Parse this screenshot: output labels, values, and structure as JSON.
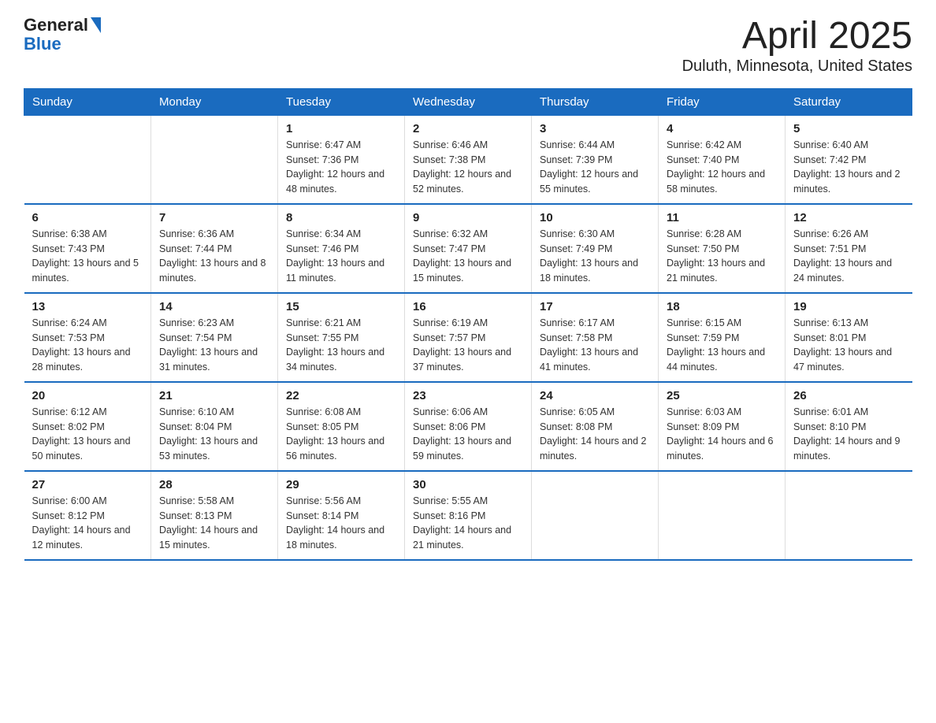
{
  "logo": {
    "text_general": "General",
    "text_blue": "Blue"
  },
  "title": "April 2025",
  "subtitle": "Duluth, Minnesota, United States",
  "weekdays": [
    "Sunday",
    "Monday",
    "Tuesday",
    "Wednesday",
    "Thursday",
    "Friday",
    "Saturday"
  ],
  "weeks": [
    [
      {
        "day": "",
        "sunrise": "",
        "sunset": "",
        "daylight": ""
      },
      {
        "day": "",
        "sunrise": "",
        "sunset": "",
        "daylight": ""
      },
      {
        "day": "1",
        "sunrise": "Sunrise: 6:47 AM",
        "sunset": "Sunset: 7:36 PM",
        "daylight": "Daylight: 12 hours and 48 minutes."
      },
      {
        "day": "2",
        "sunrise": "Sunrise: 6:46 AM",
        "sunset": "Sunset: 7:38 PM",
        "daylight": "Daylight: 12 hours and 52 minutes."
      },
      {
        "day": "3",
        "sunrise": "Sunrise: 6:44 AM",
        "sunset": "Sunset: 7:39 PM",
        "daylight": "Daylight: 12 hours and 55 minutes."
      },
      {
        "day": "4",
        "sunrise": "Sunrise: 6:42 AM",
        "sunset": "Sunset: 7:40 PM",
        "daylight": "Daylight: 12 hours and 58 minutes."
      },
      {
        "day": "5",
        "sunrise": "Sunrise: 6:40 AM",
        "sunset": "Sunset: 7:42 PM",
        "daylight": "Daylight: 13 hours and 2 minutes."
      }
    ],
    [
      {
        "day": "6",
        "sunrise": "Sunrise: 6:38 AM",
        "sunset": "Sunset: 7:43 PM",
        "daylight": "Daylight: 13 hours and 5 minutes."
      },
      {
        "day": "7",
        "sunrise": "Sunrise: 6:36 AM",
        "sunset": "Sunset: 7:44 PM",
        "daylight": "Daylight: 13 hours and 8 minutes."
      },
      {
        "day": "8",
        "sunrise": "Sunrise: 6:34 AM",
        "sunset": "Sunset: 7:46 PM",
        "daylight": "Daylight: 13 hours and 11 minutes."
      },
      {
        "day": "9",
        "sunrise": "Sunrise: 6:32 AM",
        "sunset": "Sunset: 7:47 PM",
        "daylight": "Daylight: 13 hours and 15 minutes."
      },
      {
        "day": "10",
        "sunrise": "Sunrise: 6:30 AM",
        "sunset": "Sunset: 7:49 PM",
        "daylight": "Daylight: 13 hours and 18 minutes."
      },
      {
        "day": "11",
        "sunrise": "Sunrise: 6:28 AM",
        "sunset": "Sunset: 7:50 PM",
        "daylight": "Daylight: 13 hours and 21 minutes."
      },
      {
        "day": "12",
        "sunrise": "Sunrise: 6:26 AM",
        "sunset": "Sunset: 7:51 PM",
        "daylight": "Daylight: 13 hours and 24 minutes."
      }
    ],
    [
      {
        "day": "13",
        "sunrise": "Sunrise: 6:24 AM",
        "sunset": "Sunset: 7:53 PM",
        "daylight": "Daylight: 13 hours and 28 minutes."
      },
      {
        "day": "14",
        "sunrise": "Sunrise: 6:23 AM",
        "sunset": "Sunset: 7:54 PM",
        "daylight": "Daylight: 13 hours and 31 minutes."
      },
      {
        "day": "15",
        "sunrise": "Sunrise: 6:21 AM",
        "sunset": "Sunset: 7:55 PM",
        "daylight": "Daylight: 13 hours and 34 minutes."
      },
      {
        "day": "16",
        "sunrise": "Sunrise: 6:19 AM",
        "sunset": "Sunset: 7:57 PM",
        "daylight": "Daylight: 13 hours and 37 minutes."
      },
      {
        "day": "17",
        "sunrise": "Sunrise: 6:17 AM",
        "sunset": "Sunset: 7:58 PM",
        "daylight": "Daylight: 13 hours and 41 minutes."
      },
      {
        "day": "18",
        "sunrise": "Sunrise: 6:15 AM",
        "sunset": "Sunset: 7:59 PM",
        "daylight": "Daylight: 13 hours and 44 minutes."
      },
      {
        "day": "19",
        "sunrise": "Sunrise: 6:13 AM",
        "sunset": "Sunset: 8:01 PM",
        "daylight": "Daylight: 13 hours and 47 minutes."
      }
    ],
    [
      {
        "day": "20",
        "sunrise": "Sunrise: 6:12 AM",
        "sunset": "Sunset: 8:02 PM",
        "daylight": "Daylight: 13 hours and 50 minutes."
      },
      {
        "day": "21",
        "sunrise": "Sunrise: 6:10 AM",
        "sunset": "Sunset: 8:04 PM",
        "daylight": "Daylight: 13 hours and 53 minutes."
      },
      {
        "day": "22",
        "sunrise": "Sunrise: 6:08 AM",
        "sunset": "Sunset: 8:05 PM",
        "daylight": "Daylight: 13 hours and 56 minutes."
      },
      {
        "day": "23",
        "sunrise": "Sunrise: 6:06 AM",
        "sunset": "Sunset: 8:06 PM",
        "daylight": "Daylight: 13 hours and 59 minutes."
      },
      {
        "day": "24",
        "sunrise": "Sunrise: 6:05 AM",
        "sunset": "Sunset: 8:08 PM",
        "daylight": "Daylight: 14 hours and 2 minutes."
      },
      {
        "day": "25",
        "sunrise": "Sunrise: 6:03 AM",
        "sunset": "Sunset: 8:09 PM",
        "daylight": "Daylight: 14 hours and 6 minutes."
      },
      {
        "day": "26",
        "sunrise": "Sunrise: 6:01 AM",
        "sunset": "Sunset: 8:10 PM",
        "daylight": "Daylight: 14 hours and 9 minutes."
      }
    ],
    [
      {
        "day": "27",
        "sunrise": "Sunrise: 6:00 AM",
        "sunset": "Sunset: 8:12 PM",
        "daylight": "Daylight: 14 hours and 12 minutes."
      },
      {
        "day": "28",
        "sunrise": "Sunrise: 5:58 AM",
        "sunset": "Sunset: 8:13 PM",
        "daylight": "Daylight: 14 hours and 15 minutes."
      },
      {
        "day": "29",
        "sunrise": "Sunrise: 5:56 AM",
        "sunset": "Sunset: 8:14 PM",
        "daylight": "Daylight: 14 hours and 18 minutes."
      },
      {
        "day": "30",
        "sunrise": "Sunrise: 5:55 AM",
        "sunset": "Sunset: 8:16 PM",
        "daylight": "Daylight: 14 hours and 21 minutes."
      },
      {
        "day": "",
        "sunrise": "",
        "sunset": "",
        "daylight": ""
      },
      {
        "day": "",
        "sunrise": "",
        "sunset": "",
        "daylight": ""
      },
      {
        "day": "",
        "sunrise": "",
        "sunset": "",
        "daylight": ""
      }
    ]
  ]
}
